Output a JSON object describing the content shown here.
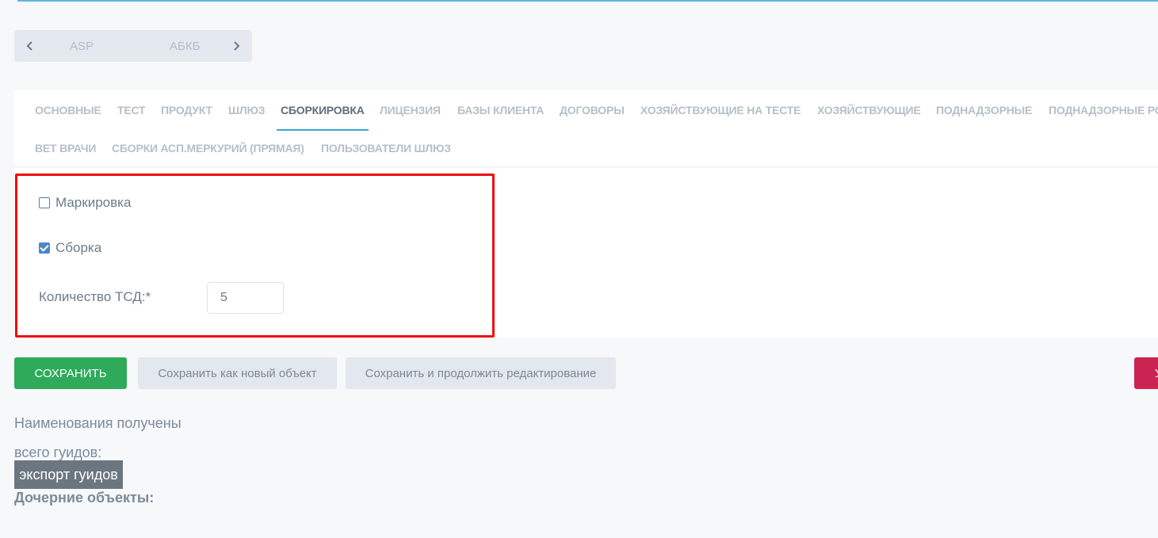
{
  "pager": {
    "prev_icon": "chevron-left-icon",
    "next_icon": "chevron-right-icon",
    "items": [
      "ASP",
      "АБКБ"
    ]
  },
  "tabs": {
    "row1": [
      "ОСНОВНЫЕ",
      "ТЕСТ",
      "ПРОДУКТ",
      "ШЛЮЗ",
      "СБОРКИРОВКА",
      "ЛИЦЕНЗИЯ",
      "БАЗЫ КЛИЕНТА",
      "ДОГОВОРЫ",
      "ХОЗЯЙСТВУЮЩИЕ НА ТЕСТЕ",
      "ХОЗЯЙСТВУЮЩИЕ",
      "ПОДНАДЗОРНЫЕ",
      "ПОДНАДЗОРНЫЕ РО"
    ],
    "row2": [
      "ВЕТ ВРАЧИ",
      "СБОРКИ АСП.МЕРКУРИЙ (ПРЯМАЯ)",
      "ПОЛЬЗОВАТЕЛИ ШЛЮЗ"
    ],
    "active": "СБОРКИРОВКА"
  },
  "form": {
    "marking_label": "Маркировка",
    "marking_checked": false,
    "assembly_label": "Сборка",
    "assembly_checked": true,
    "tsd_label": "Количество ТСД:*",
    "tsd_value": "5"
  },
  "buttons": {
    "save": "СОХРАНИТЬ",
    "save_as_new": "Сохранить как новый объект",
    "save_continue": "Сохранить и продолжить редактирование",
    "delete_partial": "У"
  },
  "info": {
    "names_received": "Наименования получены",
    "total_guids": "всего гуидов:",
    "export_guids": "экспорт гуидов",
    "child_objects": "Дочерние объекты:"
  },
  "colors": {
    "accent": "#3aa6d2",
    "save": "#2eaa5a",
    "delete": "#cc2452",
    "highlight": "#ee0f0f"
  }
}
